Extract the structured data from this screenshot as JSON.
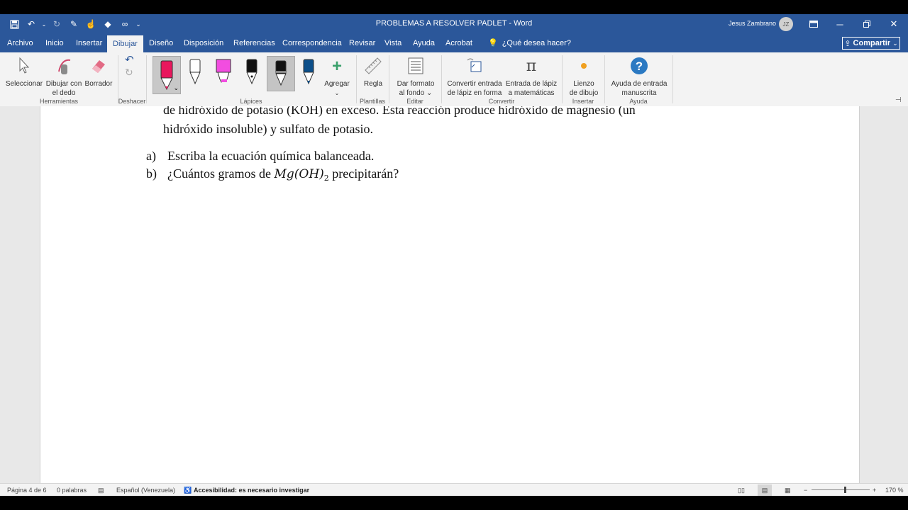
{
  "window": {
    "title": "PROBLEMAS A RESOLVER PADLET  -  Word",
    "user_name": "Jesus Zambrano",
    "user_initials": "JZ"
  },
  "tabs": [
    {
      "label": "Archivo"
    },
    {
      "label": "Inicio"
    },
    {
      "label": "Insertar"
    },
    {
      "label": "Dibujar"
    },
    {
      "label": "Diseño"
    },
    {
      "label": "Disposición"
    },
    {
      "label": "Referencias"
    },
    {
      "label": "Correspondencia"
    },
    {
      "label": "Revisar"
    },
    {
      "label": "Vista"
    },
    {
      "label": "Ayuda"
    },
    {
      "label": "Acrobat"
    }
  ],
  "tell_me": "¿Qué desea hacer?",
  "share_label": "Compartir",
  "ribbon": {
    "select_line1": "Seleccionar",
    "finger_line1": "Dibujar con",
    "finger_line2": "el dedo",
    "eraser": "Borrador",
    "group_tools": "Herramientas",
    "group_undo": "Deshacer",
    "add": "Agregar",
    "group_pens": "Lápices",
    "ruler": "Regla",
    "group_stencils": "Plantillas",
    "format_line1": "Dar formato",
    "format_line2": "al fondo",
    "group_edit": "Editar",
    "convert_line1": "Convertir entrada",
    "convert_line2": "de lápiz en forma",
    "math_line1": "Entrada de lápiz",
    "math_line2": "a matemáticas",
    "group_convert": "Convertir",
    "canvas_line1": "Lienzo",
    "canvas_line2": "de dibujo",
    "group_insert": "Insertar",
    "help_line1": "Ayuda de entrada",
    "help_line2": "manuscrita",
    "group_help": "Ayuda"
  },
  "document": {
    "line1": "de hidróxido de potasio (KOH) en exceso. Esta reacción produce hidróxido de magnesio (un",
    "line2": "hidróxido insoluble) y sulfato de potasio.",
    "item_a_marker": "a)",
    "item_a_text": "Escriba la ecuación química balanceada.",
    "item_b_marker": "b)",
    "item_b_pre": "¿Cuántos gramos de ",
    "item_b_math": "Mg(OH)",
    "item_b_sub": "2",
    "item_b_post": " precipitarán?"
  },
  "status": {
    "page": "Página 4 de 6",
    "words": "0 palabras",
    "language": "Español (Venezuela)",
    "accessibility": "Accesibilidad: es necesario investigar",
    "zoom": "170 %",
    "zoom_level": 1.7
  },
  "colors": {
    "titlebar": "#2b579a",
    "ribbon": "#f3f3f3",
    "pen_pink": "#e8175d",
    "highlighter_pink": "#f24de0",
    "pen_blue": "#0c4f8a"
  }
}
